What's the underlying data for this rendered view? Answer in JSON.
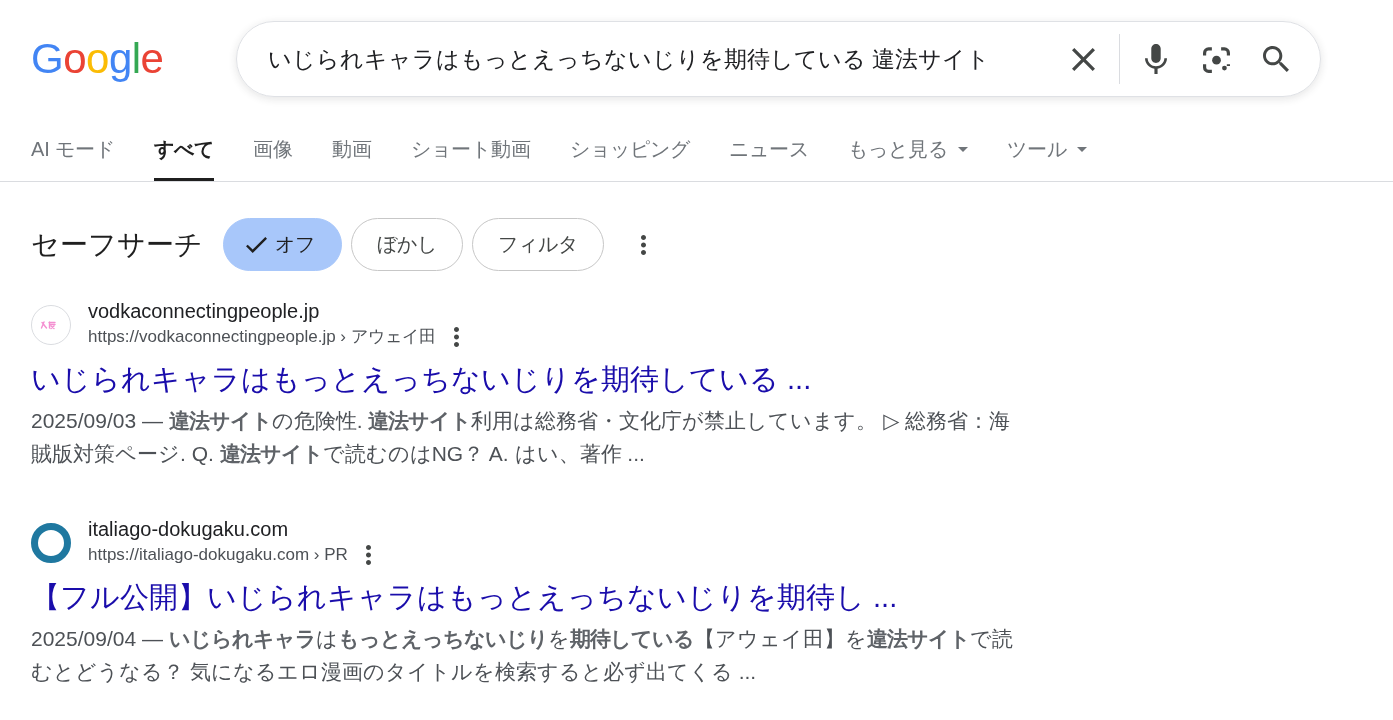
{
  "logo": {
    "text": "Google"
  },
  "search": {
    "value": "いじられキャラはもっとえっちないじりを期待している 違法サイト"
  },
  "tabs": [
    {
      "label": "AI モード",
      "selected": false,
      "dropdown": false
    },
    {
      "label": "すべて",
      "selected": true,
      "dropdown": false
    },
    {
      "label": "画像",
      "selected": false,
      "dropdown": false
    },
    {
      "label": "動画",
      "selected": false,
      "dropdown": false
    },
    {
      "label": "ショート動画",
      "selected": false,
      "dropdown": false
    },
    {
      "label": "ショッピング",
      "selected": false,
      "dropdown": false
    },
    {
      "label": "ニュース",
      "selected": false,
      "dropdown": false
    },
    {
      "label": "もっと見る",
      "selected": false,
      "dropdown": true
    },
    {
      "label": "ツール",
      "selected": false,
      "dropdown": true
    }
  ],
  "safe_search": {
    "label": "セーフサーチ",
    "options": [
      {
        "label": "オフ",
        "selected": true
      },
      {
        "label": "ぼかし",
        "selected": false
      },
      {
        "label": "フィルタ",
        "selected": false
      }
    ]
  },
  "results": [
    {
      "favicon": {
        "kind": "mark"
      },
      "site_name": "vodkaconnectingpeople.jp",
      "url": "https://vodkaconnectingpeople.jp › アウェイ田",
      "title": "いじられキャラはもっとえっちないじりを期待している ...",
      "snippet": "2025/09/03 — **違法サイト**の危険性. **違法サイト**利用は総務省・文化庁が禁止しています。 ▷ 総務省：海賊版対策ページ. Q. **違法サイト**で読むのはNG？ A. はい、著作 ..."
    },
    {
      "favicon": {
        "kind": "ring"
      },
      "site_name": "italiago-dokugaku.com",
      "url": "https://italiago-dokugaku.com › PR",
      "title": "【フル公開】いじられキャラはもっとえっちないじりを期待し ...",
      "snippet": "2025/09/04 — **いじられキャラ**は**もっとえっちないじり**を**期待している**【アウェイ田】を**違法サイト**で読むとどうなる？ 気になるエロ漫画のタイトルを検索すると必ず出てくる ..."
    }
  ]
}
